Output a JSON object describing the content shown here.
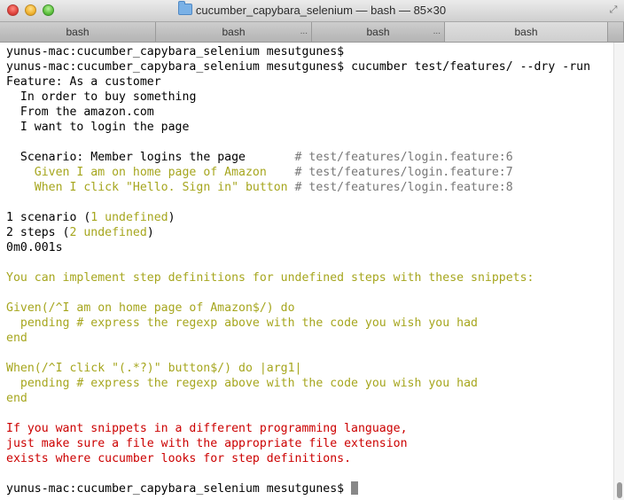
{
  "window": {
    "title": "cucumber_capybara_selenium — bash — 85×30"
  },
  "tabs": [
    {
      "label": "bash"
    },
    {
      "label": "bash"
    },
    {
      "label": "bash"
    },
    {
      "label": "bash"
    }
  ],
  "tab_overflow": "...",
  "terminal": {
    "prompt": "yunus-mac:cucumber_capybara_selenium mesutgunes$",
    "command": "cucumber test/features/ --dry -run",
    "feature_line": "Feature: As a customer",
    "feature_desc": [
      "In order to buy something",
      "From the amazon.com",
      "I want to login the page"
    ],
    "scenario": "Scenario: Member logins the page",
    "scenario_ref": "# test/features/login.feature:6",
    "step1": "Given I am on home page of Amazon",
    "step1_ref": "# test/features/login.feature:7",
    "step2": "When I click \"Hello. Sign in\" button",
    "step2_ref": "# test/features/login.feature:8",
    "summary1_pre": "1 scenario (",
    "summary1_y": "1 undefined",
    "summary1_post": ")",
    "summary2_pre": "2 steps (",
    "summary2_y": "2 undefined",
    "summary2_post": ")",
    "timing": "0m0.001s",
    "snippet_intro": "You can implement step definitions for undefined steps with these snippets:",
    "snippet1": [
      "Given(/^I am on home page of Amazon$/) do",
      "  pending # express the regexp above with the code you wish you had",
      "end"
    ],
    "snippet2": [
      "When(/^I click \"(.*?)\" button$/) do |arg1|",
      "  pending # express the regexp above with the code you wish you had",
      "end"
    ],
    "warning": [
      "If you want snippets in a different programming language,",
      "just make sure a file with the appropriate file extension",
      "exists where cucumber looks for step definitions."
    ]
  },
  "colors": {
    "undefined": "#a6a61e",
    "error": "#cc0000",
    "comment": "#777777"
  }
}
